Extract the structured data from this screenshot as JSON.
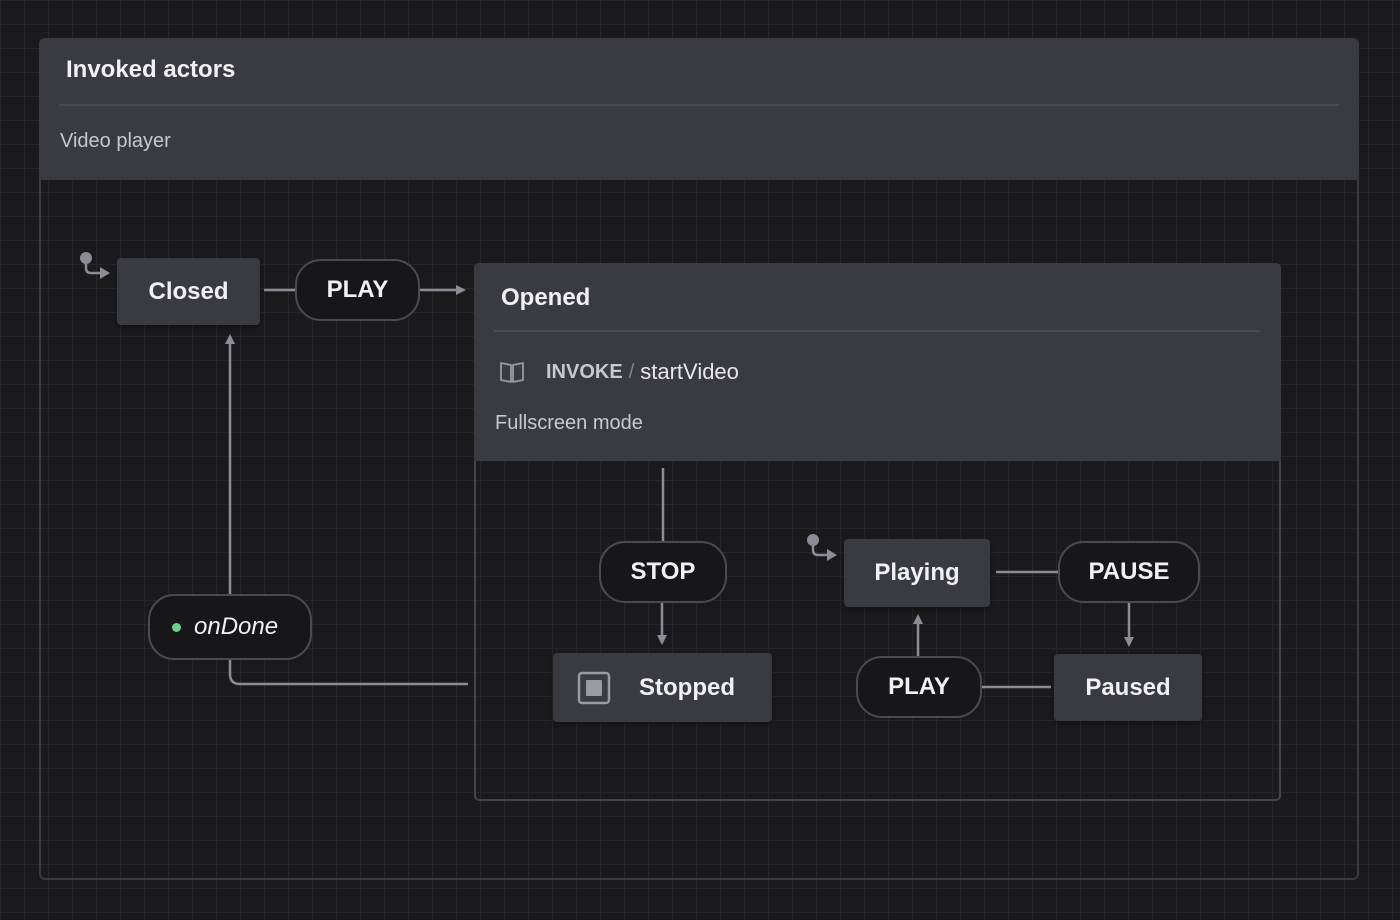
{
  "machine": {
    "title": "Invoked actors",
    "description": "Video player"
  },
  "states": {
    "closed": {
      "label": "Closed"
    },
    "opened": {
      "label": "Opened",
      "invoke_keyword": "INVOKE",
      "invoke_separator": "/",
      "invoke_source": "startVideo",
      "description": "Fullscreen mode"
    },
    "stopped": {
      "label": "Stopped"
    },
    "playing": {
      "label": "Playing"
    },
    "paused": {
      "label": "Paused"
    }
  },
  "events": {
    "play_from_closed": "PLAY",
    "stop": "STOP",
    "pause": "PAUSE",
    "play_from_paused": "PLAY",
    "on_done": "onDone"
  },
  "colors": {
    "background": "#1a1a1d",
    "state_fill": "#3a3a41",
    "edge": "#8c8c96",
    "on_done_dot": "#6ad08c"
  }
}
